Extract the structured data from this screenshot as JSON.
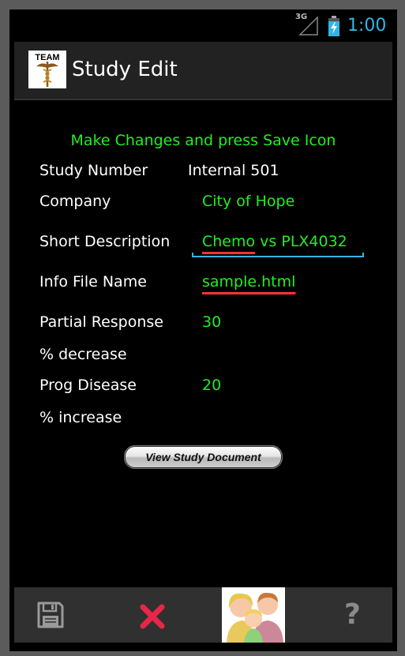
{
  "status_bar": {
    "network": "3G",
    "time": "1:00",
    "icons": [
      "signal-icon",
      "battery-charging-icon"
    ]
  },
  "action_bar": {
    "logo_text": "TEAM",
    "title": "Study Edit"
  },
  "form": {
    "instruction": "Make Changes and press Save Icon",
    "study_number_label": "Study Number",
    "study_number_value": "Internal 501",
    "company_label": "Company",
    "company_value": "City of Hope",
    "short_description_label": "Short Description",
    "short_description_value_part1": "Chemo",
    "short_description_value_part2": " vs PLX4032",
    "info_file_label": "Info File Name",
    "info_file_value": "sample.html",
    "partial_response_label": "Partial Response",
    "partial_response_value": "30",
    "percent_decrease_label": "% decrease",
    "prog_disease_label": "Prog Disease",
    "prog_disease_value": "20",
    "percent_increase_label": "% increase",
    "view_document_button": "View Study Document"
  },
  "toolbar": {
    "items": [
      "save-icon",
      "cancel-icon",
      "family-icon",
      "help-icon"
    ],
    "help_glyph": "?"
  },
  "colors": {
    "accent": "#33b5e5",
    "value_green": "#22ee22",
    "spellcheck_red": "#ff3333",
    "cancel_red": "#e8264a"
  }
}
